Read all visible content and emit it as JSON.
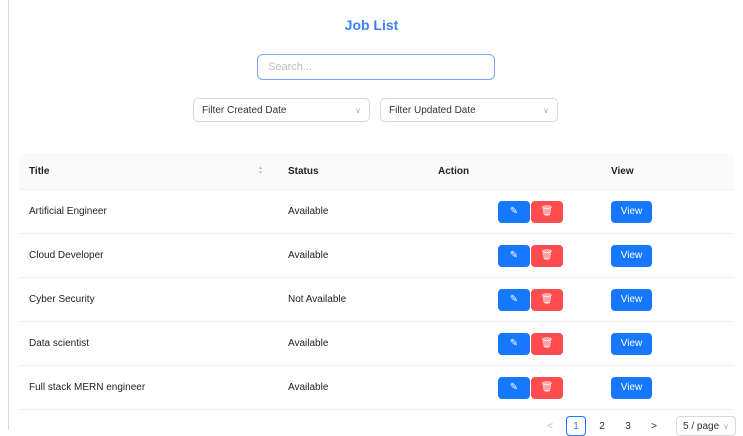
{
  "page": {
    "title": "Job List"
  },
  "search": {
    "placeholder": "Search..."
  },
  "filters": {
    "created": {
      "label": "Filter Created Date"
    },
    "updated": {
      "label": "Filter Updated Date"
    }
  },
  "table": {
    "headers": {
      "title": "Title",
      "status": "Status",
      "action": "Action",
      "view": "View"
    },
    "rows": [
      {
        "title": "Artificial Engineer",
        "status": "Available",
        "view": "View"
      },
      {
        "title": "Cloud Developer",
        "status": "Available",
        "view": "View"
      },
      {
        "title": "Cyber Security",
        "status": "Not Available",
        "view": "View"
      },
      {
        "title": "Data scientist",
        "status": "Available",
        "view": "View"
      },
      {
        "title": "Full stack MERN engineer",
        "status": "Available",
        "view": "View"
      }
    ]
  },
  "pagination": {
    "prev": "<",
    "pages": [
      "1",
      "2",
      "3"
    ],
    "current": "1",
    "next": ">",
    "page_size": "5 / page"
  },
  "colors": {
    "primary": "#1677ff",
    "danger": "#ff4d4f",
    "title": "#3b82f6"
  },
  "icons": {
    "edit": "edit-icon",
    "delete": "delete-icon",
    "sort": "sort-icon",
    "chevron": "chevron-down-icon"
  }
}
